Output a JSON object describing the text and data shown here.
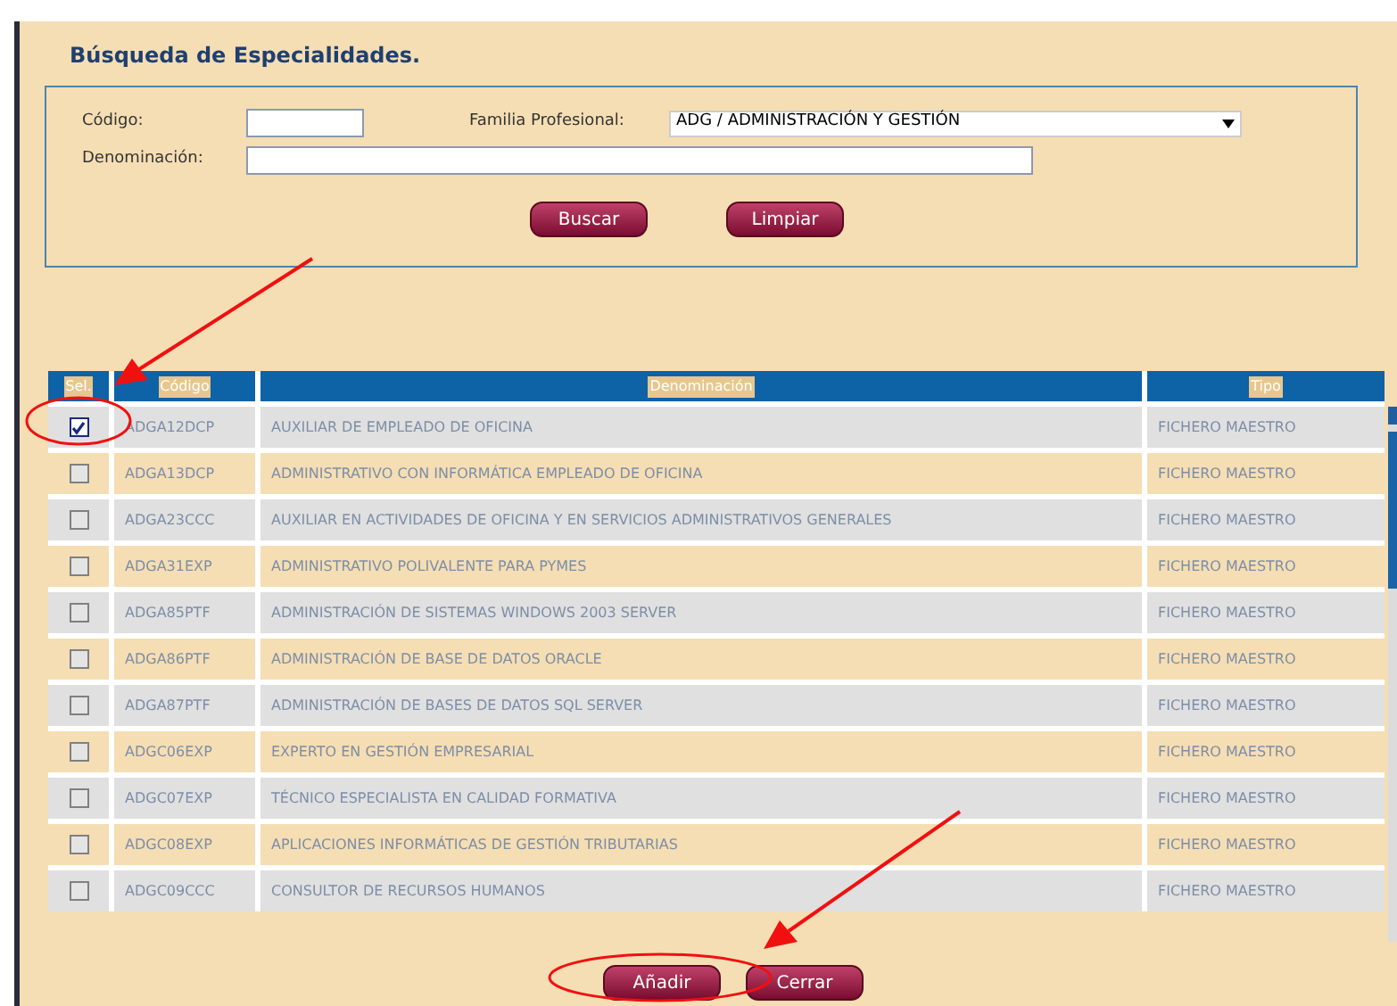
{
  "title": "Búsqueda de Especialidades.",
  "search": {
    "codigo": {
      "label": "Código:"
    },
    "familia": {
      "label": "Familia Profesional:",
      "value": "ADG / ADMINISTRACIÓN Y GESTIÓN"
    },
    "denominacion": {
      "label": "Denominación:"
    },
    "buttons": [
      "Buscar",
      "Limpiar"
    ]
  },
  "table": {
    "columns": [
      "Sel.",
      "Código",
      "Denominación",
      "Tipo"
    ],
    "rows": [
      {
        "checked": true,
        "code": "ADGA12DCP",
        "name": "AUXILIAR DE EMPLEADO DE OFICINA",
        "type": "FICHERO MAESTRO"
      },
      {
        "checked": false,
        "code": "ADGA13DCP",
        "name": "ADMINISTRATIVO CON INFORMÁTICA EMPLEADO DE OFICINA",
        "type": "FICHERO MAESTRO"
      },
      {
        "checked": false,
        "code": "ADGA23CCC",
        "name": "AUXILIAR EN ACTIVIDADES DE OFICINA Y EN SERVICIOS ADMINISTRATIVOS GENERALES",
        "type": "FICHERO MAESTRO"
      },
      {
        "checked": false,
        "code": "ADGA31EXP",
        "name": "ADMINISTRATIVO POLIVALENTE PARA PYMES",
        "type": "FICHERO MAESTRO"
      },
      {
        "checked": false,
        "code": "ADGA85PTF",
        "name": "ADMINISTRACIÓN DE SISTEMAS WINDOWS 2003 SERVER",
        "type": "FICHERO MAESTRO"
      },
      {
        "checked": false,
        "code": "ADGA86PTF",
        "name": "ADMINISTRACIÓN DE BASE DE DATOS ORACLE",
        "type": "FICHERO MAESTRO"
      },
      {
        "checked": false,
        "code": "ADGA87PTF",
        "name": "ADMINISTRACIÓN DE BASES DE DATOS SQL SERVER",
        "type": "FICHERO MAESTRO"
      },
      {
        "checked": false,
        "code": "ADGC06EXP",
        "name": "EXPERTO EN GESTIÓN EMPRESARIAL",
        "type": "FICHERO MAESTRO"
      },
      {
        "checked": false,
        "code": "ADGC07EXP",
        "name": "TÉCNICO ESPECIALISTA EN CALIDAD FORMATIVA",
        "type": "FICHERO MAESTRO"
      },
      {
        "checked": false,
        "code": "ADGC08EXP",
        "name": "APLICACIONES INFORMÁTICAS DE GESTIÓN TRIBUTARIAS",
        "type": "FICHERO MAESTRO"
      },
      {
        "checked": false,
        "code": "ADGC09CCC",
        "name": "CONSULTOR DE RECURSOS HUMANOS",
        "type": "FICHERO MAESTRO"
      }
    ]
  },
  "buttons": [
    "Añadir",
    "Cerrar"
  ]
}
